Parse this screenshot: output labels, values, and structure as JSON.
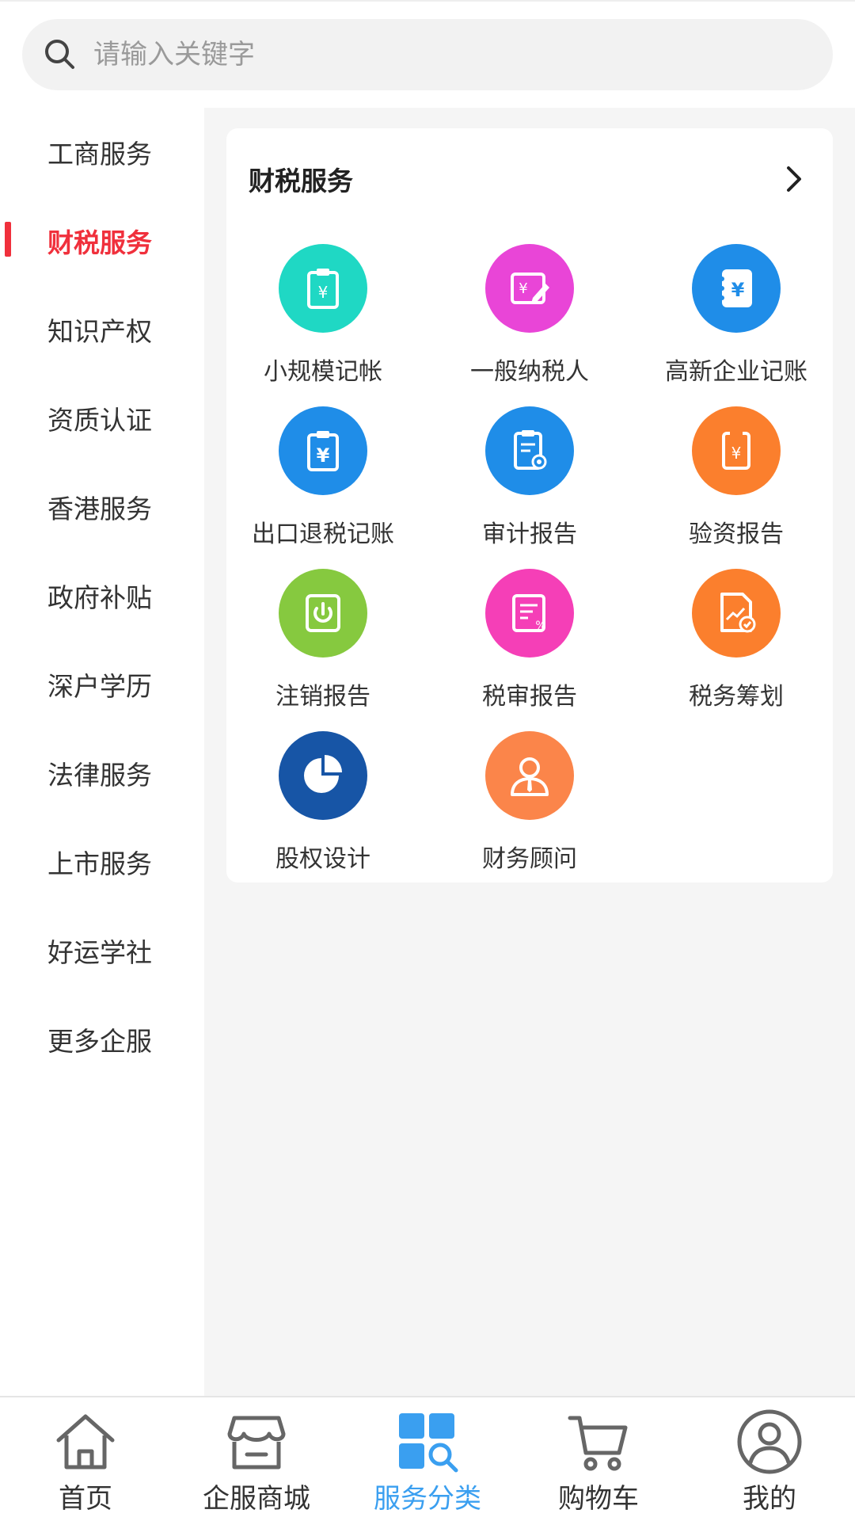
{
  "search": {
    "placeholder": "请输入关键字"
  },
  "sidebar": {
    "items": [
      {
        "label": "工商服务",
        "active": false
      },
      {
        "label": "财税服务",
        "active": true
      },
      {
        "label": "知识产权",
        "active": false
      },
      {
        "label": "资质认证",
        "active": false
      },
      {
        "label": "香港服务",
        "active": false
      },
      {
        "label": "政府补贴",
        "active": false
      },
      {
        "label": "深户学历",
        "active": false
      },
      {
        "label": "法律服务",
        "active": false
      },
      {
        "label": "上市服务",
        "active": false
      },
      {
        "label": "好运学社",
        "active": false
      },
      {
        "label": "更多企服",
        "active": false
      }
    ]
  },
  "section": {
    "title": "财税服务",
    "services": [
      {
        "label": "小规模记帐",
        "icon": "clipboard-yen-icon",
        "color": "#1fd8c4"
      },
      {
        "label": "一般纳税人",
        "icon": "yen-pen-icon",
        "color": "#e945d7"
      },
      {
        "label": "高新企业记账",
        "icon": "yen-notebook-icon",
        "color": "#1f8de8"
      },
      {
        "label": "出口退税记账",
        "icon": "clipboard-yen-icon",
        "color": "#1f8de8"
      },
      {
        "label": "审计报告",
        "icon": "report-gear-icon",
        "color": "#1f8de8"
      },
      {
        "label": "验资报告",
        "icon": "yen-document-icon",
        "color": "#fb7f2d"
      },
      {
        "label": "注销报告",
        "icon": "power-icon",
        "color": "#86c93f"
      },
      {
        "label": "税审报告",
        "icon": "tax-form-icon",
        "color": "#f53fb7"
      },
      {
        "label": "税务筹划",
        "icon": "trend-check-icon",
        "color": "#fb7f2d"
      },
      {
        "label": "股权设计",
        "icon": "pie-chart-icon",
        "color": "#1755a6"
      },
      {
        "label": "财务顾问",
        "icon": "consultant-icon",
        "color": "#fb854a"
      }
    ]
  },
  "tabbar": {
    "tabs": [
      {
        "label": "首页",
        "icon": "home-icon"
      },
      {
        "label": "企服商城",
        "icon": "store-icon"
      },
      {
        "label": "服务分类",
        "icon": "category-icon"
      },
      {
        "label": "购物车",
        "icon": "cart-icon"
      },
      {
        "label": "我的",
        "icon": "user-icon"
      }
    ],
    "active_color": "#3a9ff0"
  }
}
